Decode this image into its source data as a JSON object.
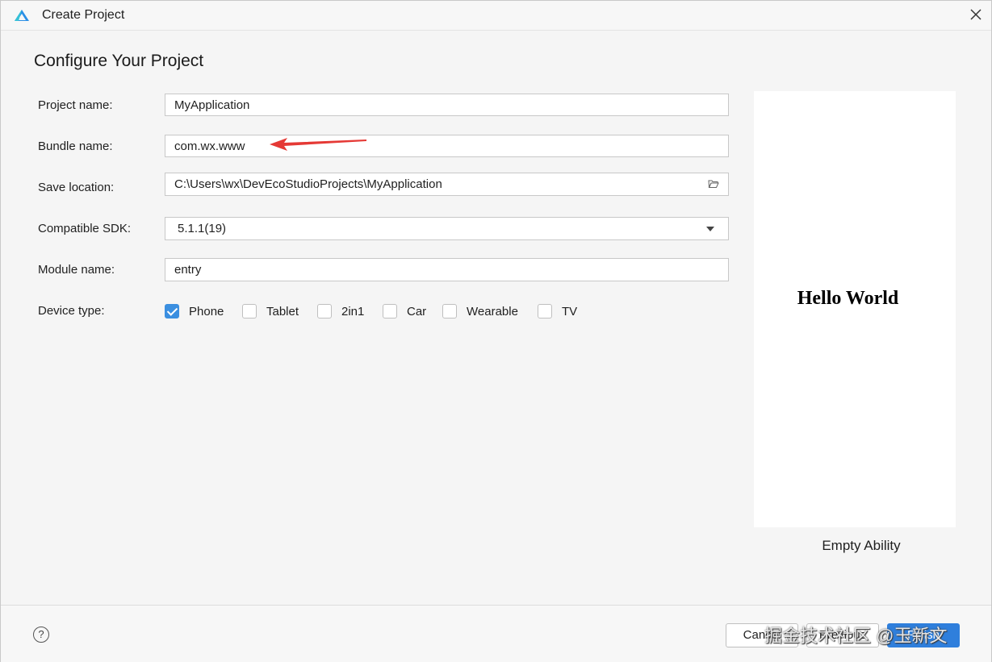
{
  "window": {
    "title": "Create Project"
  },
  "page": {
    "heading": "Configure Your Project"
  },
  "form": {
    "project_name": {
      "label": "Project name:",
      "value": "MyApplication"
    },
    "bundle_name": {
      "label": "Bundle name:",
      "value": "com.wx.www"
    },
    "save_location": {
      "label": "Save location:",
      "value": "C:\\Users\\wx\\DevEcoStudioProjects\\MyApplication"
    },
    "compatible_sdk": {
      "label": "Compatible SDK:",
      "value": "5.1.1(19)"
    },
    "module_name": {
      "label": "Module name:",
      "value": "entry"
    },
    "device_type": {
      "label": "Device type:",
      "options": [
        {
          "label": "Phone",
          "checked": true
        },
        {
          "label": "Tablet",
          "checked": false
        },
        {
          "label": "2in1",
          "checked": false
        },
        {
          "label": "Car",
          "checked": false
        },
        {
          "label": "Wearable",
          "checked": false
        },
        {
          "label": "TV",
          "checked": false
        }
      ]
    }
  },
  "preview": {
    "screen_text": "Hello World",
    "template_name": "Empty Ability"
  },
  "footer": {
    "help": "?",
    "cancel": "Cancel",
    "previous": "Previous",
    "finish": "Finish",
    "watermark": "掘金技术社区 @玉新文"
  },
  "icons": {
    "app": "deveco-logo-icon",
    "close": "close-icon",
    "folder": "folder-icon",
    "dropdown": "chevron-down-icon",
    "help": "help-icon",
    "annotation": "red-arrow"
  },
  "colors": {
    "accent": "#2f7fdc",
    "checkbox": "#3b8fe0",
    "annotation": "#e53935"
  }
}
